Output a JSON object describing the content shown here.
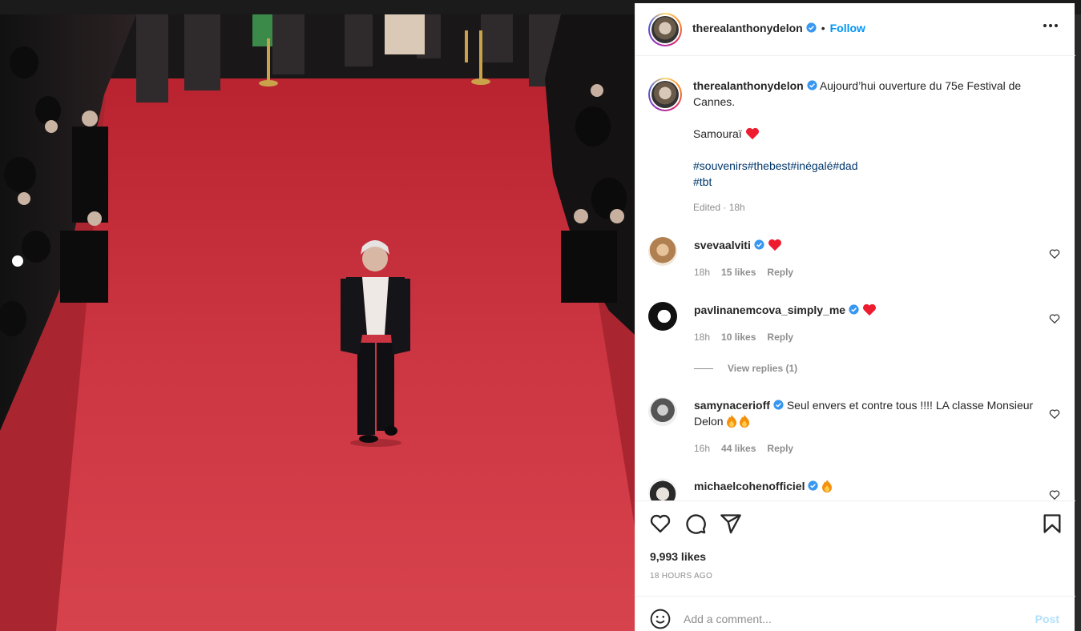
{
  "post": {
    "author": "therealanthonydelon",
    "follow_label": "Follow",
    "dot": "•",
    "caption_line1": "Aujourd’hui ouverture du 75e Festival de Cannes.",
    "caption_line2": "Samouraï",
    "hashtags_line1": "#souvenirs#thebest#inégalé#dad",
    "hashtags_line2": "#tbt",
    "edited": "Edited · 18h",
    "likes": "9,993 likes",
    "time_ago": "18 HOURS AGO"
  },
  "comments": [
    {
      "user": "svevaalviti",
      "text": "",
      "emoji": "heart",
      "time": "18h",
      "likes": "15 likes",
      "reply": "Reply"
    },
    {
      "user": "pavlinanemcova_simply_me",
      "text": "",
      "emoji": "heart",
      "time": "18h",
      "likes": "10 likes",
      "reply": "Reply",
      "view_replies": "View replies (1)"
    },
    {
      "user": "samynacerioff",
      "text": "Seul envers et contre tous !!!! LA classe Monsieur Delon",
      "emoji": "fire-fire",
      "time": "16h",
      "likes": "44 likes",
      "reply": "Reply"
    },
    {
      "user": "michaelcohenofficiel",
      "text": "",
      "emoji": "fire"
    }
  ],
  "comment_box": {
    "placeholder": "Add a comment...",
    "post_label": "Post"
  },
  "icons": {
    "like": "heart-outline-icon",
    "comment": "speech-bubble-icon",
    "share": "paper-plane-icon",
    "save": "bookmark-icon",
    "emoji": "smiley-icon",
    "more": "more-dots-icon",
    "verified": "verified-badge-icon"
  },
  "colors": {
    "accent": "#0095f6",
    "verified": "#3897f0",
    "heart": "#ed4956",
    "text": "#262626",
    "muted": "#8e8e8e",
    "post_disabled": "#b2dffc",
    "carpet": "#c7323e"
  }
}
